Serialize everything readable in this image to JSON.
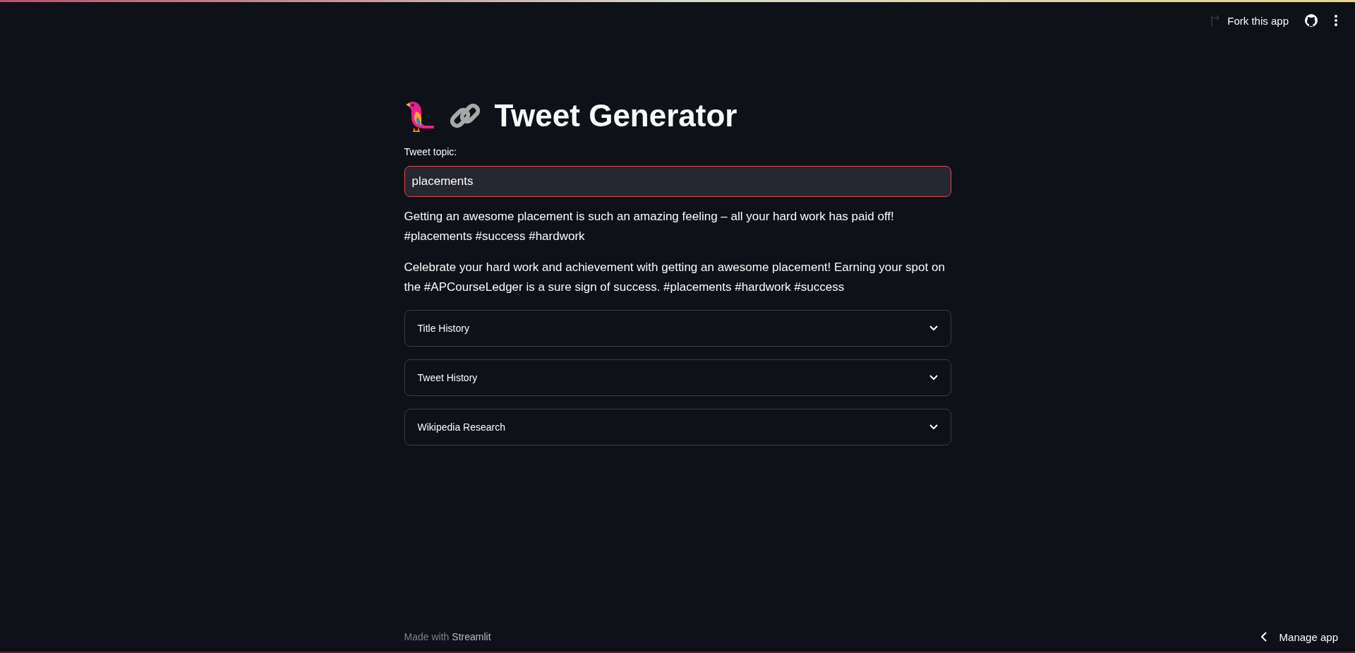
{
  "header": {
    "fork_label": "Fork this app"
  },
  "title": "Tweet Generator",
  "topic_field": {
    "label": "Tweet topic:",
    "value": "placements"
  },
  "tweets": [
    "Getting an awesome placement is such an amazing feeling – all your hard work has paid off! #placements #success #hardwork",
    "Celebrate your hard work and achievement with getting an awesome placement! Earning your spot on the #APCourseLedger is a sure sign of success. #placements #hardwork #success"
  ],
  "expanders": [
    {
      "label": "Title History",
      "expanded": false
    },
    {
      "label": "Tweet History",
      "expanded": false
    },
    {
      "label": "Wikipedia Research",
      "expanded": false
    }
  ],
  "footer": {
    "made_with": "Made with",
    "brand": "Streamlit",
    "manage": "Manage app"
  }
}
